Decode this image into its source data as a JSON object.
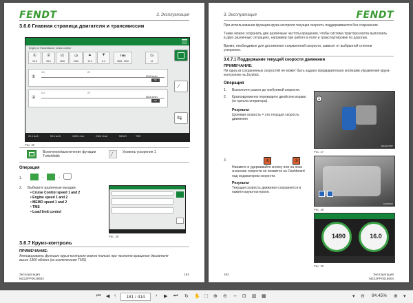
{
  "left_page": {
    "logo": "FENDT",
    "section": "3. Эксплуатация",
    "heading": "3.6.6 Главная страница двигателя и трансмиссии",
    "terminal": {
      "title": "Engine & Transmission: Cruise control",
      "icon1": {
        "value": "20.6",
        "unit": "km/h"
      },
      "icon2": {
        "value": "55.6",
        "unit": "km/h"
      },
      "icon3": {
        "value": "1600",
        "unit": "1/min"
      },
      "icon4": {
        "value": "2160",
        "unit": "1/min"
      },
      "icon5": {
        "label": "MEMO",
        "value": "10.0",
        "unit": "km/h"
      },
      "icon6": {
        "value": "6.0",
        "unit": "km/h"
      },
      "tms": {
        "label": "TMS",
        "value": "1563 - 1940",
        "unit": "1/min"
      },
      "icon8": {
        "value": "12",
        "unit": "%"
      },
      "slider1": {
        "min": "0,0",
        "mid": "20",
        "readout": "20,6 km/h",
        "thumb": "S1"
      },
      "slider2": {
        "min": "0,0",
        "mid": "20",
        "readout": "55,6 km/h",
        "thumb": "S2"
      },
      "status": [
        "20.4 km/h",
        "55.6 km/h",
        "1600 1/min",
        "2160 1/min",
        "MEMO",
        "TMS"
      ]
    },
    "fig1": "Рис. 35",
    "legend1": "Включение/выключение функции TurboMatik",
    "legend2": "Уровень ускорения 1",
    "op_heading": "Операция",
    "step1_num": "1.",
    "step2_num": "2.",
    "step2_text": "Выберите различные вкладки:",
    "bullets": [
      "Cruise Control speed 1 and 2",
      "Engine speed 1 and 2",
      "MEMO speed 1 and 2",
      "TMS",
      "Load limit control"
    ],
    "fig2": "Рис. 36",
    "heading2": "3.6.7 Круиз-контроль",
    "note_head": "ПРИМЕЧАНИЕ:",
    "note_body": "Активировать функцию круиз-контроля можно только при частоте вращения двигателя выше 1300 об/мин (за исключением TMS)",
    "footer_left_1": "Эксплуатация",
    "footer_left_2": "MZ22PP0018604",
    "page_num_left": "181"
  },
  "right_page": {
    "logo": "FENDT",
    "section": "3. Эксплуатация",
    "para1": "При использовании функции круиз-контроля текущая скорость поддерживается без сохранения.",
    "para2": "Также можно сохранить две различные частоты вращения, чтобы система трактора могла выполнить в двух различных ситуациях, например при работе в поле и транспортировке по дорогам.",
    "para3": "Время, необходимое для достижения сохраненной скорости, зависит от выбранной степени ускорения.",
    "heading": "3.6.7.1 Поддержание текущей скорости движения",
    "note_head": "ПРИМЕЧАНИЕ:",
    "note_body": "Ни одна из сохраненных скоростей не может быть задано предварительно кнопками управления круиз-контролем на Joystick.",
    "op_heading": "Операция",
    "step1": "Выполните разгон до требуемой скорости.",
    "step2": "Кратковременно переведите джойстик вправо (от кресла оператора).",
    "res1_head": "Результат",
    "res1_body": "Целевая скорость = это текущая скорость движения",
    "fig37": "Рис. 37",
    "step3": "Нажмите и удерживайте кнопку или на пока значение скорости не появится на Dashboard над индикатором скорости.",
    "res2_head": "Результат",
    "res2_body": "Текущая скорость движения сохраняется в памяти круиз-контроля.",
    "fig38": "Рис. 38",
    "gauge_left": "1490",
    "gauge_right": "16.0",
    "fig39": "Рис. 39",
    "photo_code1": "RDAR1780T",
    "photo_code2": "FAR99207",
    "footer_right_1": "Эксплуатация",
    "footer_right_2": "MZ22PP0018604",
    "page_num_right": "182"
  },
  "toolbar": {
    "page_indicator": "181 / 414",
    "zoom": "84.45%"
  }
}
